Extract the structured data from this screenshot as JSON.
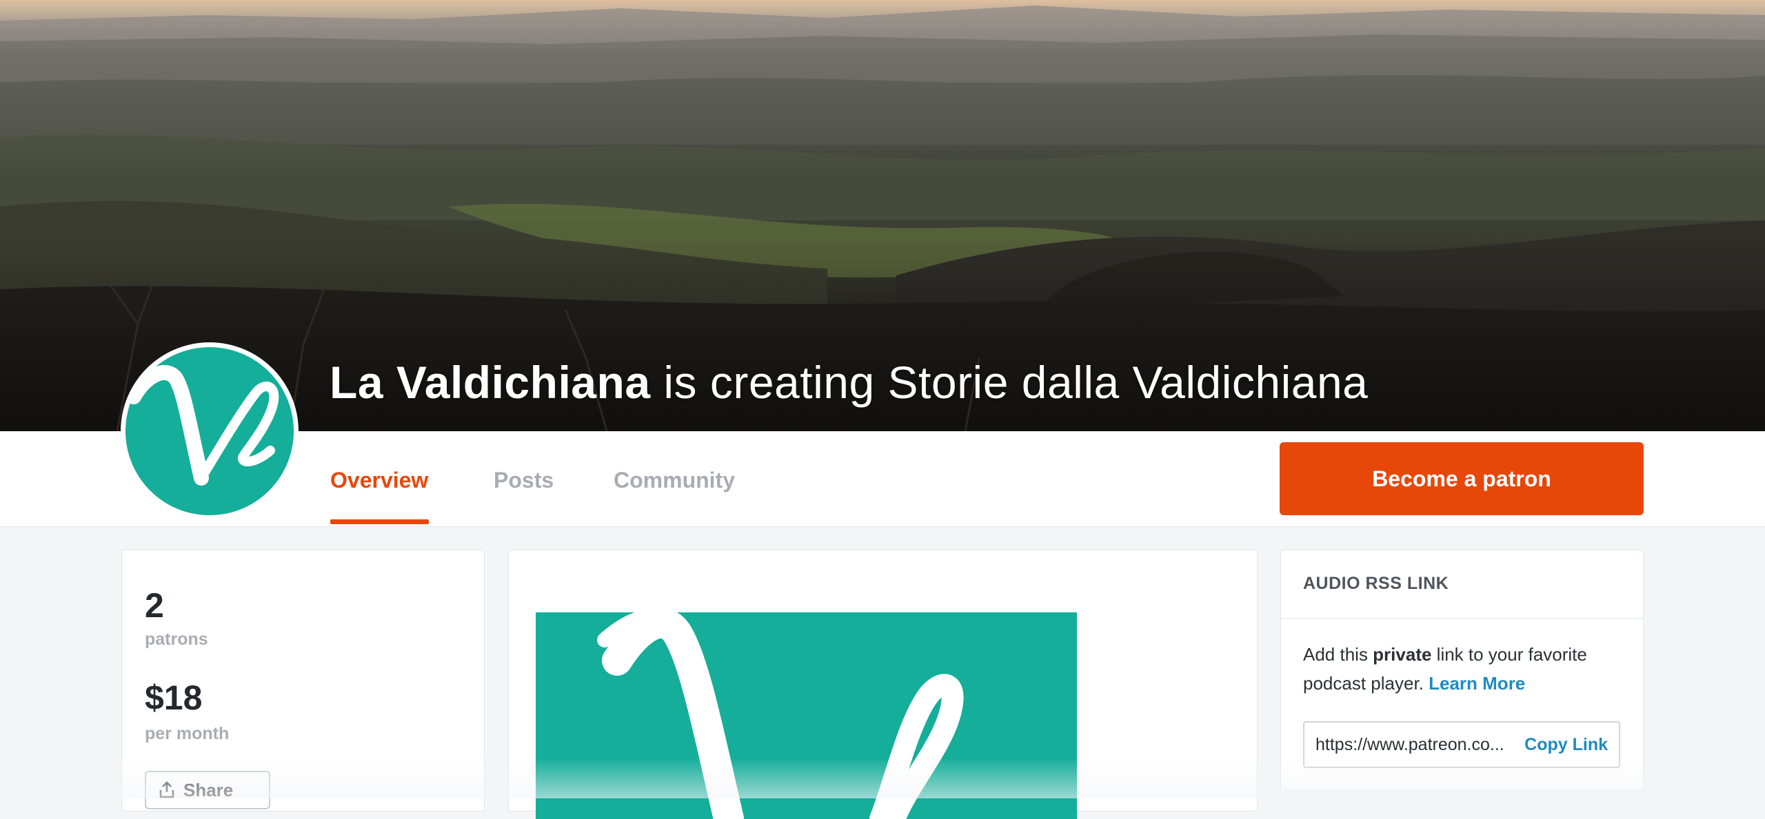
{
  "hero": {
    "creator_name": "La Valdichiana",
    "creating_text": " is creating Storie dalla Valdichiana"
  },
  "nav": {
    "tabs": [
      {
        "label": "Overview",
        "active": true
      },
      {
        "label": "Posts",
        "active": false
      },
      {
        "label": "Community",
        "active": false
      }
    ],
    "cta_label": "Become a patron"
  },
  "stats": {
    "patrons_count": "2",
    "patrons_label": "patrons",
    "amount": "$18",
    "amount_label": "per month",
    "share_label": "Share"
  },
  "rss": {
    "title": "AUDIO RSS LINK",
    "text_before": "Add this ",
    "text_bold": "private",
    "text_after": " link to your favorite podcast player. ",
    "learn_more": "Learn More",
    "url": "https://www.patreon.co...",
    "copy_label": "Copy Link"
  },
  "colors": {
    "accent": "#e8470a",
    "brand_teal": "#14ae9a",
    "link_blue": "#1f8ac0"
  },
  "icons": {
    "share": "share-icon",
    "logo": "valdichiana-v-logo"
  }
}
